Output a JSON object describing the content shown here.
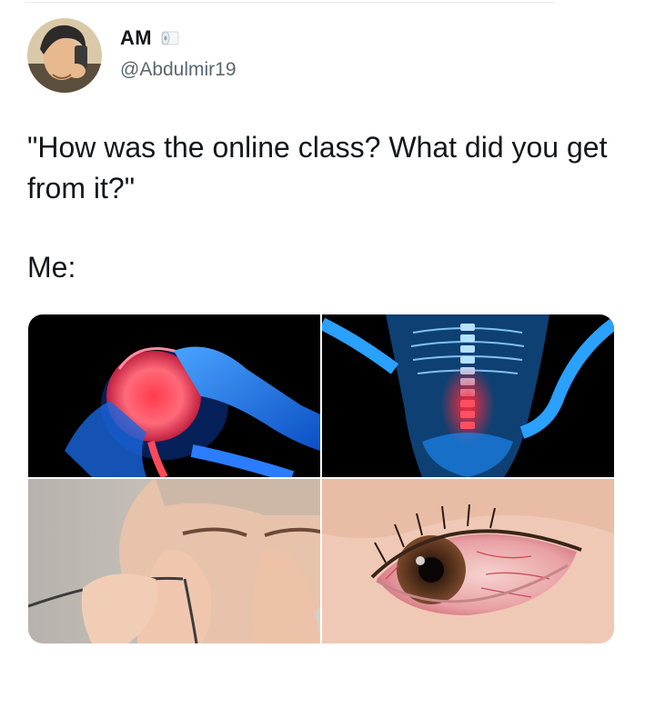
{
  "tweet": {
    "author": {
      "display_name": "AM",
      "badge_icon": "toilet-paper-icon",
      "handle": "@Abdulmir19",
      "avatar_icon": "anime-selfie-avatar"
    },
    "text_lines": [
      "\"How was the online class? What did you get from it?\"",
      "Me:"
    ],
    "media": [
      {
        "name": "headache-xray-image",
        "icon": "headache-icon"
      },
      {
        "name": "back-pain-xray-image",
        "icon": "spine-pain-icon"
      },
      {
        "name": "eye-strain-photo",
        "icon": "tired-eyes-icon"
      },
      {
        "name": "red-eye-photo",
        "icon": "red-eye-icon"
      }
    ]
  },
  "colors": {
    "text": "#14171a",
    "secondary_text": "#5b6670",
    "xray_blue": "#1e8fff",
    "pain_red": "#ff2a3a"
  }
}
